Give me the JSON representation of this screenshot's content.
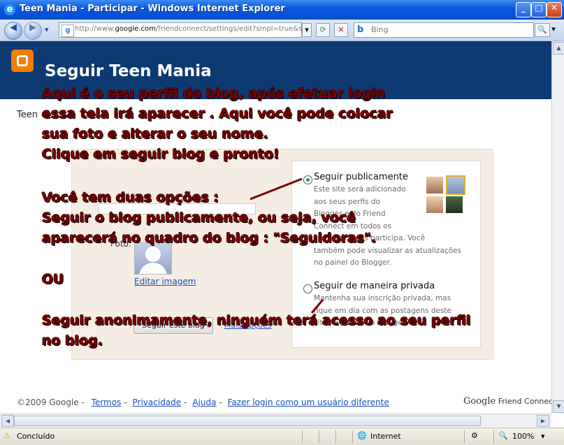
{
  "window": {
    "title": "Teen Mania - Participar - Windows Internet Explorer",
    "minimize": "_",
    "maximize": "□",
    "close": "✕"
  },
  "toolbar": {
    "back": "◀",
    "forward": "▶",
    "dropdown": "▾",
    "url_prefix": "http://www.",
    "url_domain": "google.com",
    "url_rest": "/friendconnect/settings/edit?smpl=true&sl",
    "refresh": "⟳",
    "stop": "✕",
    "search_placeholder": "Bing",
    "search_icon": "🔍"
  },
  "page": {
    "header_title": "Seguir Teen Mania",
    "site_name_prefix": "Teen",
    "photo_label": "Foto:",
    "edit_image": "Editar imagem",
    "follow_button": "Seguir este blog",
    "more_options": "Mais opções"
  },
  "options": {
    "public": {
      "title": "Seguir publicamente",
      "desc_lines": [
        "Este site será adicionado",
        "aos seus perfis do",
        "Blogger e do Friend",
        "Connect em todos os",
        "sites dos quais participa. Você",
        "também pode visualizar as atualizações",
        "no painel do Blogger."
      ]
    },
    "private": {
      "title": "Seguir de maneira privada",
      "desc_lines": [
        "Mantenha sua inscrição privada, mas",
        "fique em dia com as postagens deste",
        "site no painel do Blogger."
      ]
    }
  },
  "overlay": {
    "lines": [
      "Aqui é o seu perfil do blog, após efetuar login",
      "essa tela irá aparecer . Aqui você pode colocar",
      "sua foto e alterar o seu nome.",
      "Clique em seguir blog e pronto!",
      "Você tem duas opções :",
      "Seguir o blog publicamente, ou seja, você",
      "aparecerá no quadro do blog : \"Seguidoras\".",
      "OU",
      "Seguir anonimamente, ninguém terá acesso ao seu perfil",
      "no blog."
    ]
  },
  "footer": {
    "copyright": "©2009 Google -",
    "links": [
      "Termos",
      "Privacidade",
      "Ajuda",
      "Fazer login como um usuário diferente"
    ],
    "gfc_brand": "Google",
    "gfc_text": "Friend Connect"
  },
  "status": {
    "text": "Concluído",
    "zone": "Internet",
    "zoom": "100%"
  },
  "colors": {
    "header_bg": "#0e3a73",
    "overlay_text": "#7a0000",
    "link": "#1a4ec0"
  }
}
